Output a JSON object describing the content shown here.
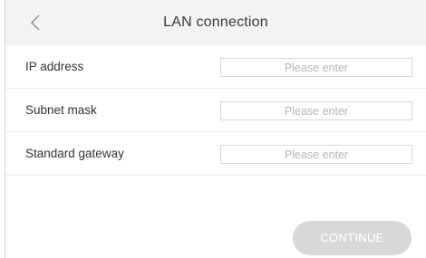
{
  "header": {
    "title": "LAN connection",
    "back_icon": "chevron-left-icon"
  },
  "fields": [
    {
      "label": "IP address",
      "placeholder": "Please enter",
      "value": ""
    },
    {
      "label": "Subnet mask",
      "placeholder": "Please enter",
      "value": ""
    },
    {
      "label": "Standard gateway",
      "placeholder": "Please enter",
      "value": ""
    }
  ],
  "actions": {
    "continue_label": "CONTINUE"
  },
  "colors": {
    "header_bg": "#f3f3f5",
    "button_disabled_bg": "#d8d8d8",
    "placeholder_text": "#b5b5b5"
  }
}
